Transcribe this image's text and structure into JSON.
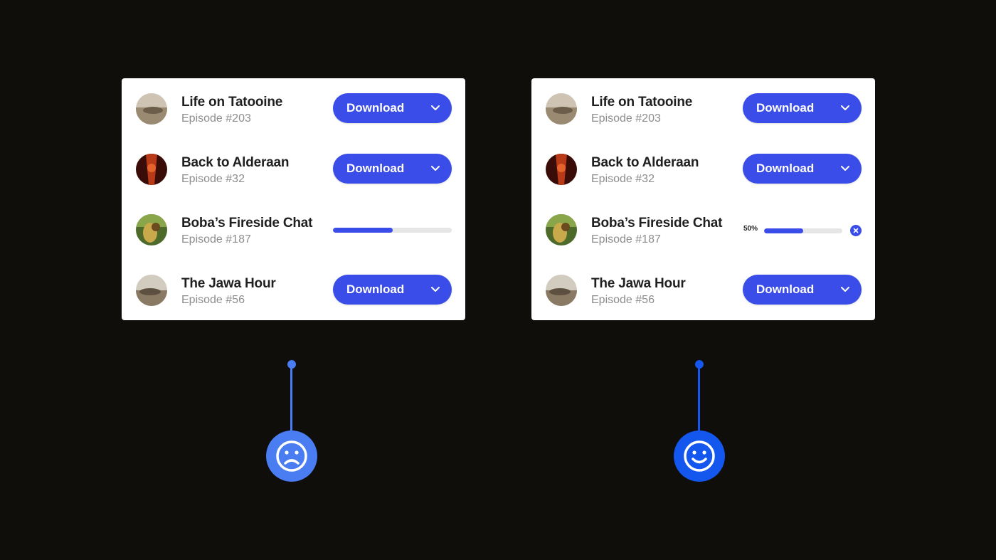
{
  "colors": {
    "background": "#0f0e0a",
    "accent": "#3b4de8",
    "sad_indicator": "#4a7cf2",
    "happy_indicator": "#1357ef"
  },
  "episodes": [
    {
      "title": "Life on Tatooine",
      "episode": "Episode #203",
      "button": "Download"
    },
    {
      "title": "Back to Alderaan",
      "episode": "Episode #32",
      "button": "Download"
    },
    {
      "title": "Boba’s Fireside Chat",
      "episode": "Episode #187",
      "progress": 0.5
    },
    {
      "title": "The Jawa Hour",
      "episode": "Episode #56",
      "button": "Download"
    }
  ],
  "right_progress_label": "50%",
  "icons": {
    "dropdown": "chevron-down-icon",
    "cancel": "close-icon",
    "bad_example": "sad-face-icon",
    "good_example": "happy-face-icon"
  }
}
